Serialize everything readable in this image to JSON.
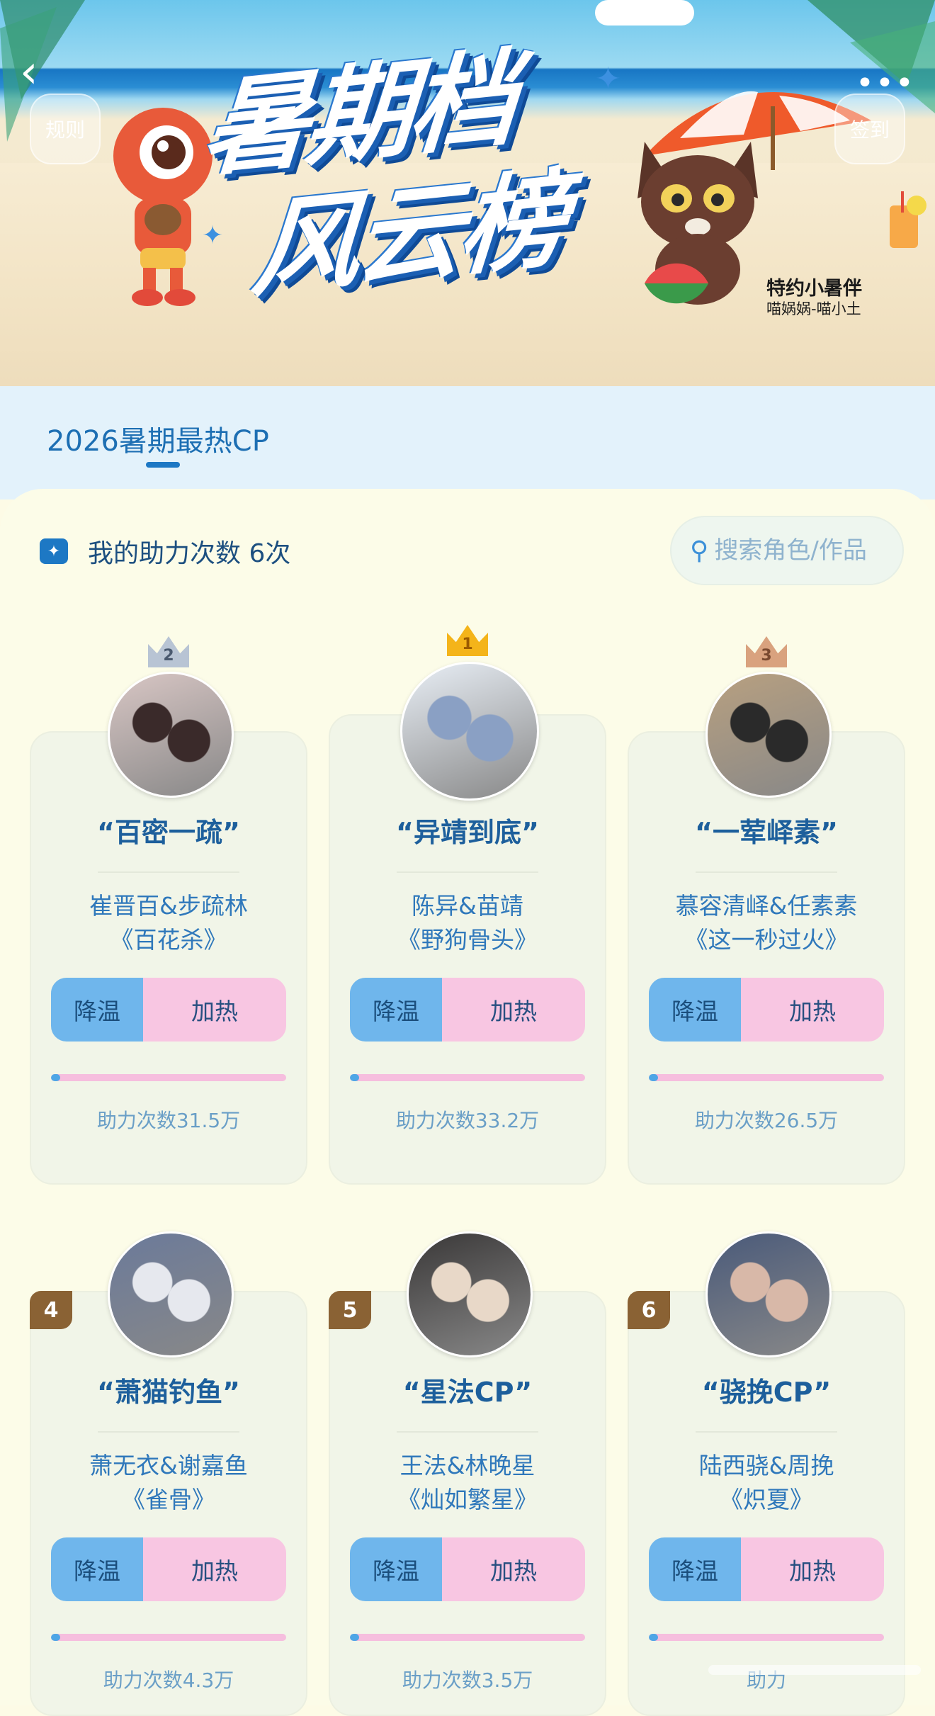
{
  "banner": {
    "title_line1": "暑期档",
    "title_line2": "风云榜",
    "sponsor_label": "特约小暑伴",
    "sponsor_names": "喵娲娲-喵小土",
    "rules_label": "规则",
    "checkin_label": "签到"
  },
  "tab": {
    "title": "2026暑期最热CP"
  },
  "helper": {
    "label": "我的助力次数 6次"
  },
  "search": {
    "placeholder": "搜索角色/作品"
  },
  "buttons": {
    "cool": "降温",
    "heat": "加热"
  },
  "cards": [
    {
      "rank": "2",
      "name": "“百密一疏”",
      "chars": "崔晋百&步疏林",
      "work": "《百花杀》",
      "count": "助力次数31.5万",
      "progress": 0.04
    },
    {
      "rank": "1",
      "name": "“异靖到底”",
      "chars": "陈异&苗靖",
      "work": "《野狗骨头》",
      "count": "助力次数33.2万",
      "progress": 0.04
    },
    {
      "rank": "3",
      "name": "“一荤峄素”",
      "chars": "慕容清峄&任素素",
      "work": "《这一秒过火》",
      "count": "助力次数26.5万",
      "progress": 0.04
    },
    {
      "rank": "4",
      "name": "“萧猫钓鱼”",
      "chars": "萧无衣&谢嘉鱼",
      "work": "《雀骨》",
      "count": "助力次数4.3万",
      "progress": 0.04
    },
    {
      "rank": "5",
      "name": "“星法CP”",
      "chars": "王法&林晚星",
      "work": "《灿如繁星》",
      "count": "助力次数3.5万",
      "progress": 0.04
    },
    {
      "rank": "6",
      "name": "“骁挽CP”",
      "chars": "陆西骁&周挽",
      "work": "《炽夏》",
      "count": "助力",
      "progress": 0.04
    }
  ],
  "colors": {
    "crown_gold": "#f4b41a",
    "crown_silver": "#b8c4d4",
    "crown_bronze": "#d9a27e",
    "rank_badge": "#8a6234",
    "accent_blue": "#1d78c4"
  }
}
